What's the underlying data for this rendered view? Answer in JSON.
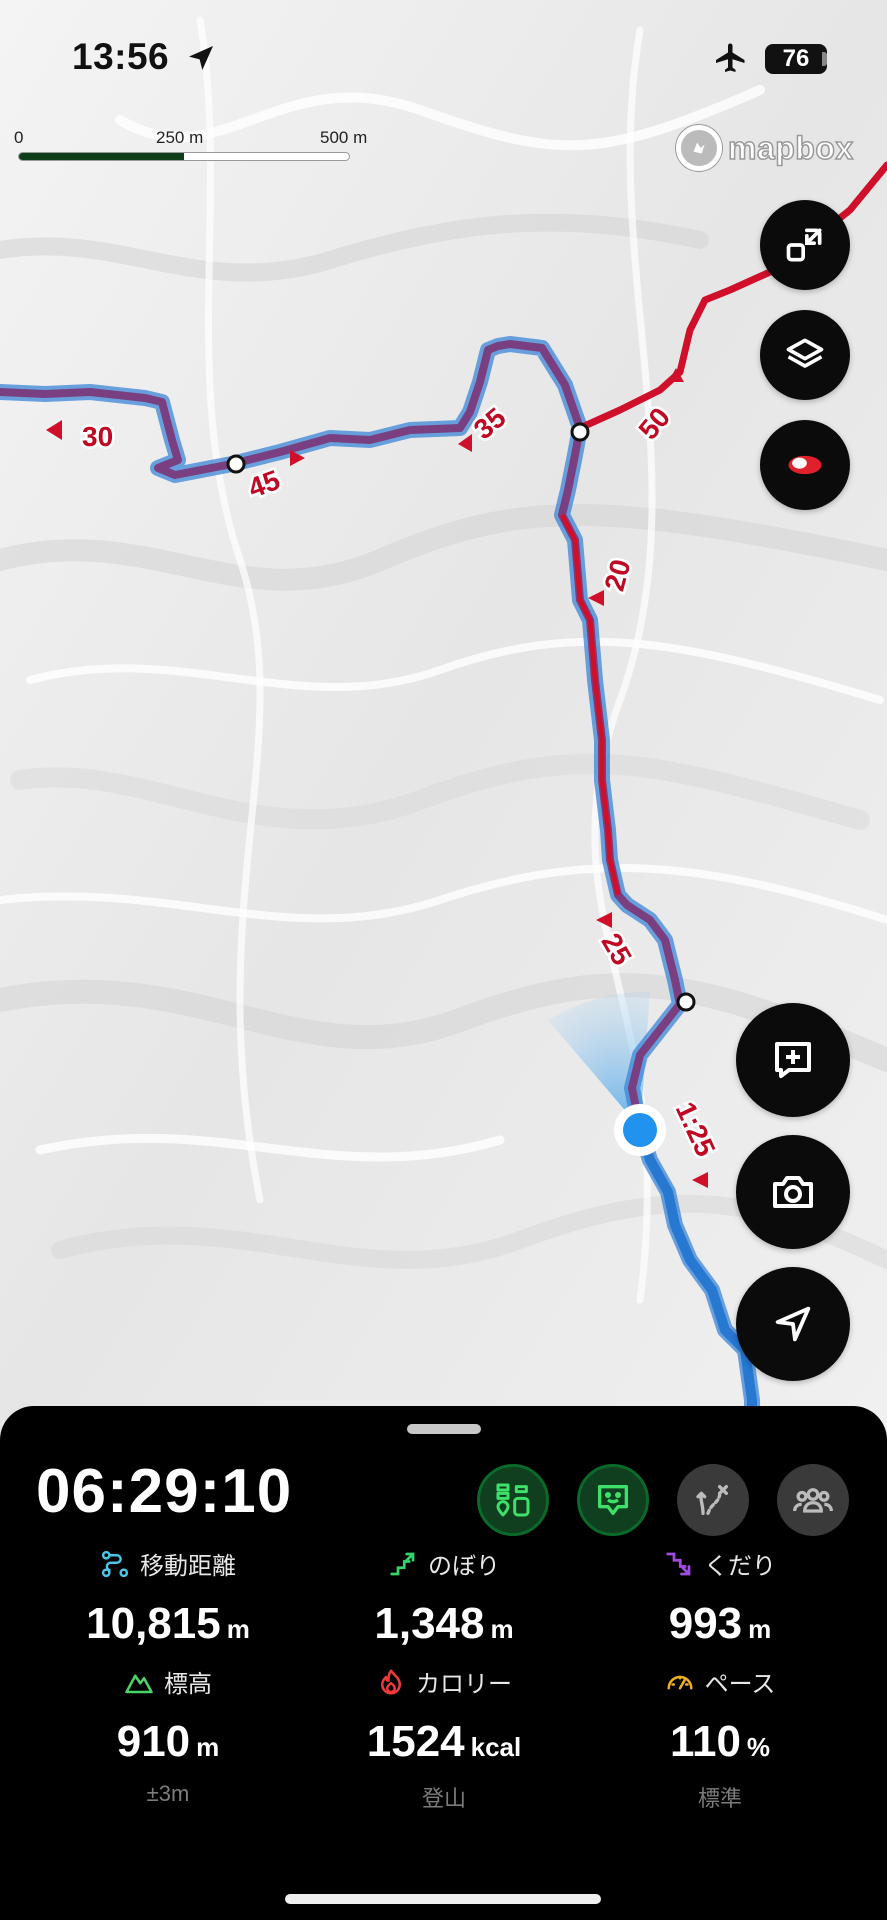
{
  "status_bar": {
    "time": "13:56",
    "battery": "76"
  },
  "scale": {
    "start": "0",
    "mid": "250 m",
    "end": "500 m",
    "filled_fraction": 0.5
  },
  "map": {
    "attribution": "mapbox",
    "waypoint_labels": [
      "30",
      "45",
      "35",
      "50",
      "20",
      "25",
      "1:25"
    ],
    "colors": {
      "route_red": "#d0102a",
      "route_purple": "#7a3f80",
      "track_blue": "#3b86d8",
      "position": "#2192ee"
    },
    "controls": [
      "fullscreen-toggle",
      "layers",
      "overlay-toggle",
      "add-note",
      "camera",
      "locate"
    ]
  },
  "panel": {
    "elapsed": "06:29:10",
    "modes": [
      "map-offline",
      "status-face",
      "route-off",
      "group"
    ],
    "stats": [
      {
        "label": "移動距離",
        "value": "10,815",
        "unit": "m",
        "sub": ""
      },
      {
        "label": "のぼり",
        "value": "1,348",
        "unit": "m",
        "sub": ""
      },
      {
        "label": "くだり",
        "value": "993",
        "unit": "m",
        "sub": ""
      },
      {
        "label": "標高",
        "value": "910",
        "unit": "m",
        "sub": "±3m"
      },
      {
        "label": "カロリー",
        "value": "1524",
        "unit": "kcal",
        "sub": "登山"
      },
      {
        "label": "ペース",
        "value": "110",
        "unit": "%",
        "sub": "標準"
      }
    ]
  }
}
